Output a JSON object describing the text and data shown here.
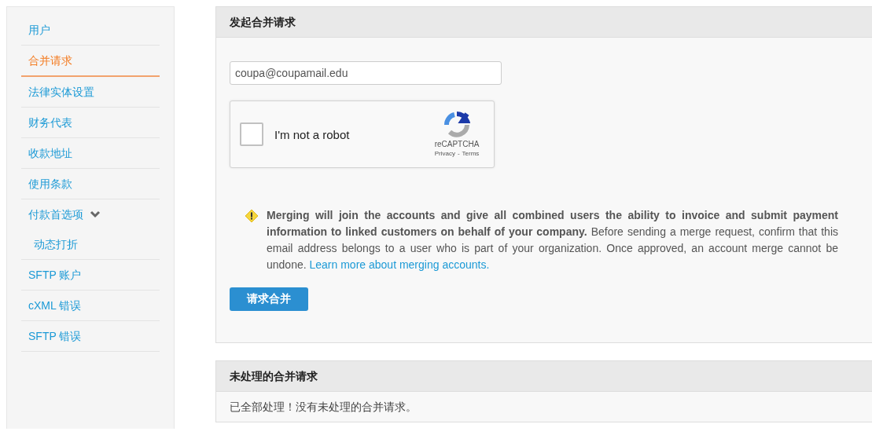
{
  "sidebar": {
    "items": [
      {
        "label": "用户",
        "selected": false
      },
      {
        "label": "合并请求",
        "selected": true
      },
      {
        "label": "法律实体设置",
        "selected": false
      },
      {
        "label": "财务代表",
        "selected": false
      },
      {
        "label": "收款地址",
        "selected": false
      },
      {
        "label": "使用条款",
        "selected": false
      },
      {
        "label": "付款首选项",
        "selected": false,
        "expanded": true,
        "children": [
          {
            "label": "动态打折",
            "selected": false
          }
        ]
      },
      {
        "label": "SFTP 账户",
        "selected": false
      },
      {
        "label": "cXML 错误",
        "selected": false
      },
      {
        "label": "SFTP 错误",
        "selected": false
      }
    ]
  },
  "merge_panel": {
    "title": "发起合并请求",
    "email": {
      "value": "coupa@coupamail.edu"
    },
    "captcha": {
      "label": "I'm not a robot",
      "checked": false,
      "brand": "reCAPTCHA",
      "privacy": "Privacy",
      "separator": "-",
      "terms": "Terms"
    },
    "notice": {
      "text": "**Merging will join the accounts and give all combined users the ability to invoice and submit payment information to linked customers on behalf of your company.** Before sending a merge request, confirm that this email address belongs to a user who is part of your organization. Once approved, an account merge cannot be undone. ",
      "link": "Learn more about merging accounts."
    },
    "button": "请求合并"
  },
  "pending_panel": {
    "title": "未处理的合并请求",
    "message": "已全部处理！没有未处理的合并请求。"
  }
}
